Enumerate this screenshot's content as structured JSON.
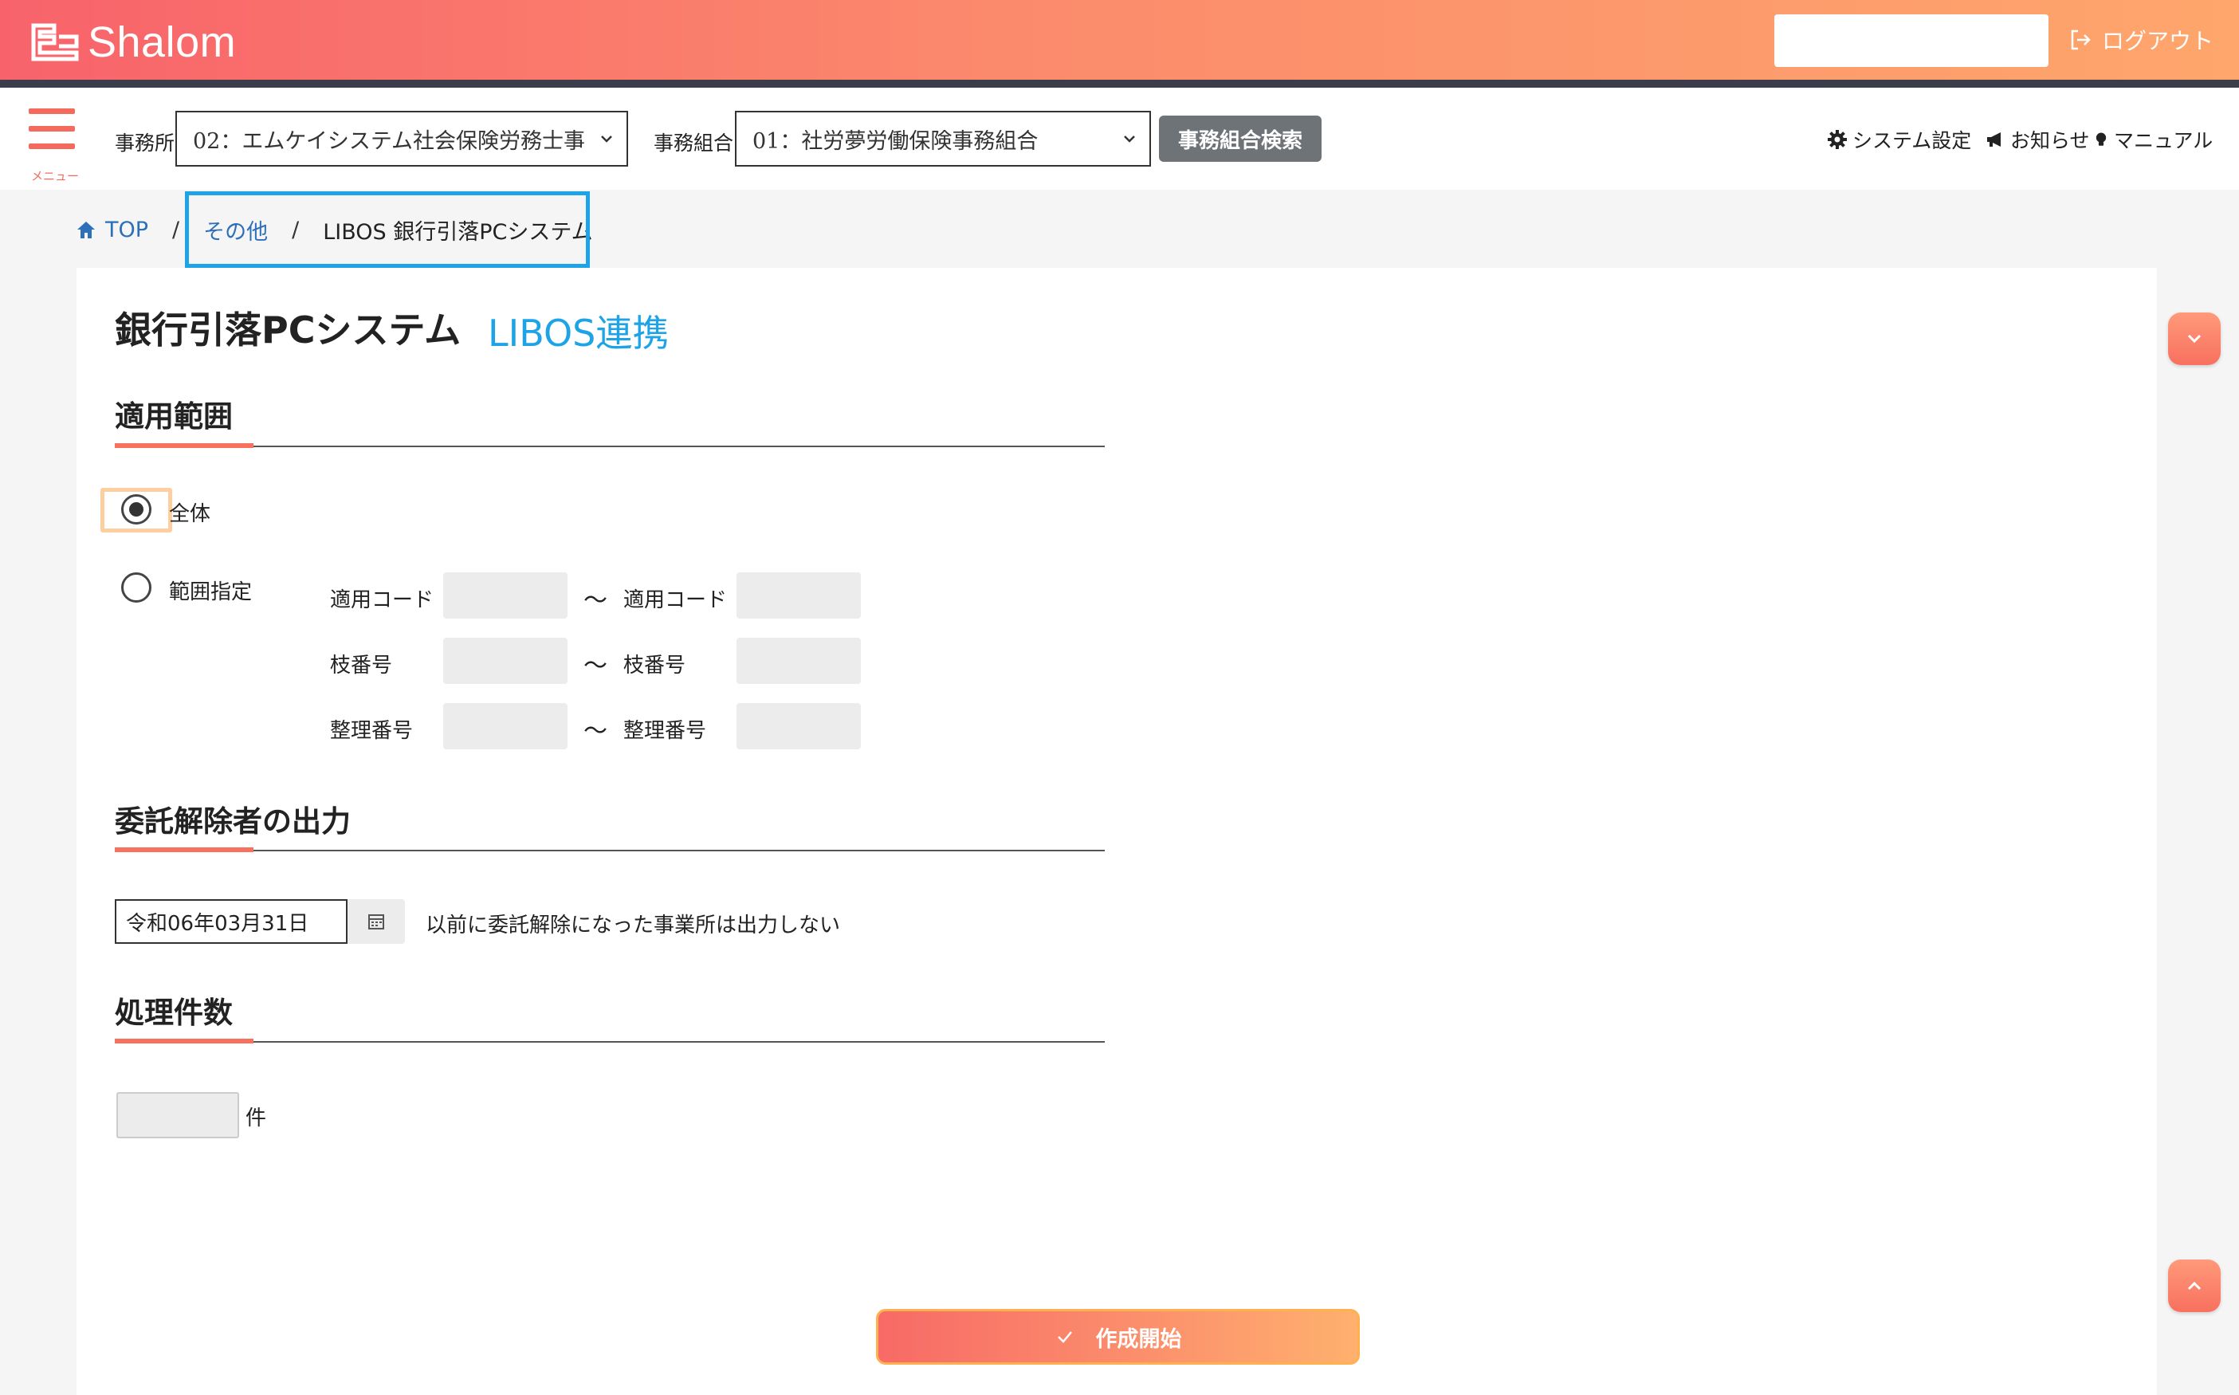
{
  "header": {
    "logo_text": "Shalom",
    "logout_label": "ログアウト",
    "gradient_colors": [
      "#f8636b",
      "#fea66c"
    ]
  },
  "toolbar": {
    "menu_label": "メニュー",
    "office_label": "事務所",
    "office_value": "02：エムケイシステム社会保険労務士事",
    "union_label": "事務組合",
    "union_value": "01：社労夢労働保険事務組合",
    "union_search_label": "事務組合検索",
    "system_settings_label": "システム設定",
    "notice_label": "お知らせ",
    "manual_label": "マニュアル"
  },
  "breadcrumb": {
    "top": "TOP",
    "sep1": "/",
    "other": "その他",
    "sep2": "/",
    "current": "LIBOS 銀行引落PCシステム"
  },
  "page": {
    "title": "銀行引落PCシステム",
    "subtitle": "LIBOS連携"
  },
  "scope_section": {
    "title": "適用範囲",
    "radio_all_label": "全体",
    "radio_range_label": "範囲指定",
    "selected": "全体",
    "rows": [
      {
        "from_label": "適用コード",
        "tilde": "〜",
        "to_label": "適用コード"
      },
      {
        "from_label": "枝番号",
        "tilde": "〜",
        "to_label": "枝番号"
      },
      {
        "from_label": "整理番号",
        "tilde": "〜",
        "to_label": "整理番号"
      }
    ]
  },
  "cancel_section": {
    "title": "委託解除者の出力",
    "date_value": "令和06年03月31日",
    "note": "以前に委託解除になった事業所は出力しない"
  },
  "count_section": {
    "title": "処理件数",
    "value": "",
    "unit": "件"
  },
  "actions": {
    "start_label": "作成開始"
  },
  "colors": {
    "accent": "#f7715e",
    "link": "#2d6fb8",
    "highlight": "#1ea4e6"
  }
}
